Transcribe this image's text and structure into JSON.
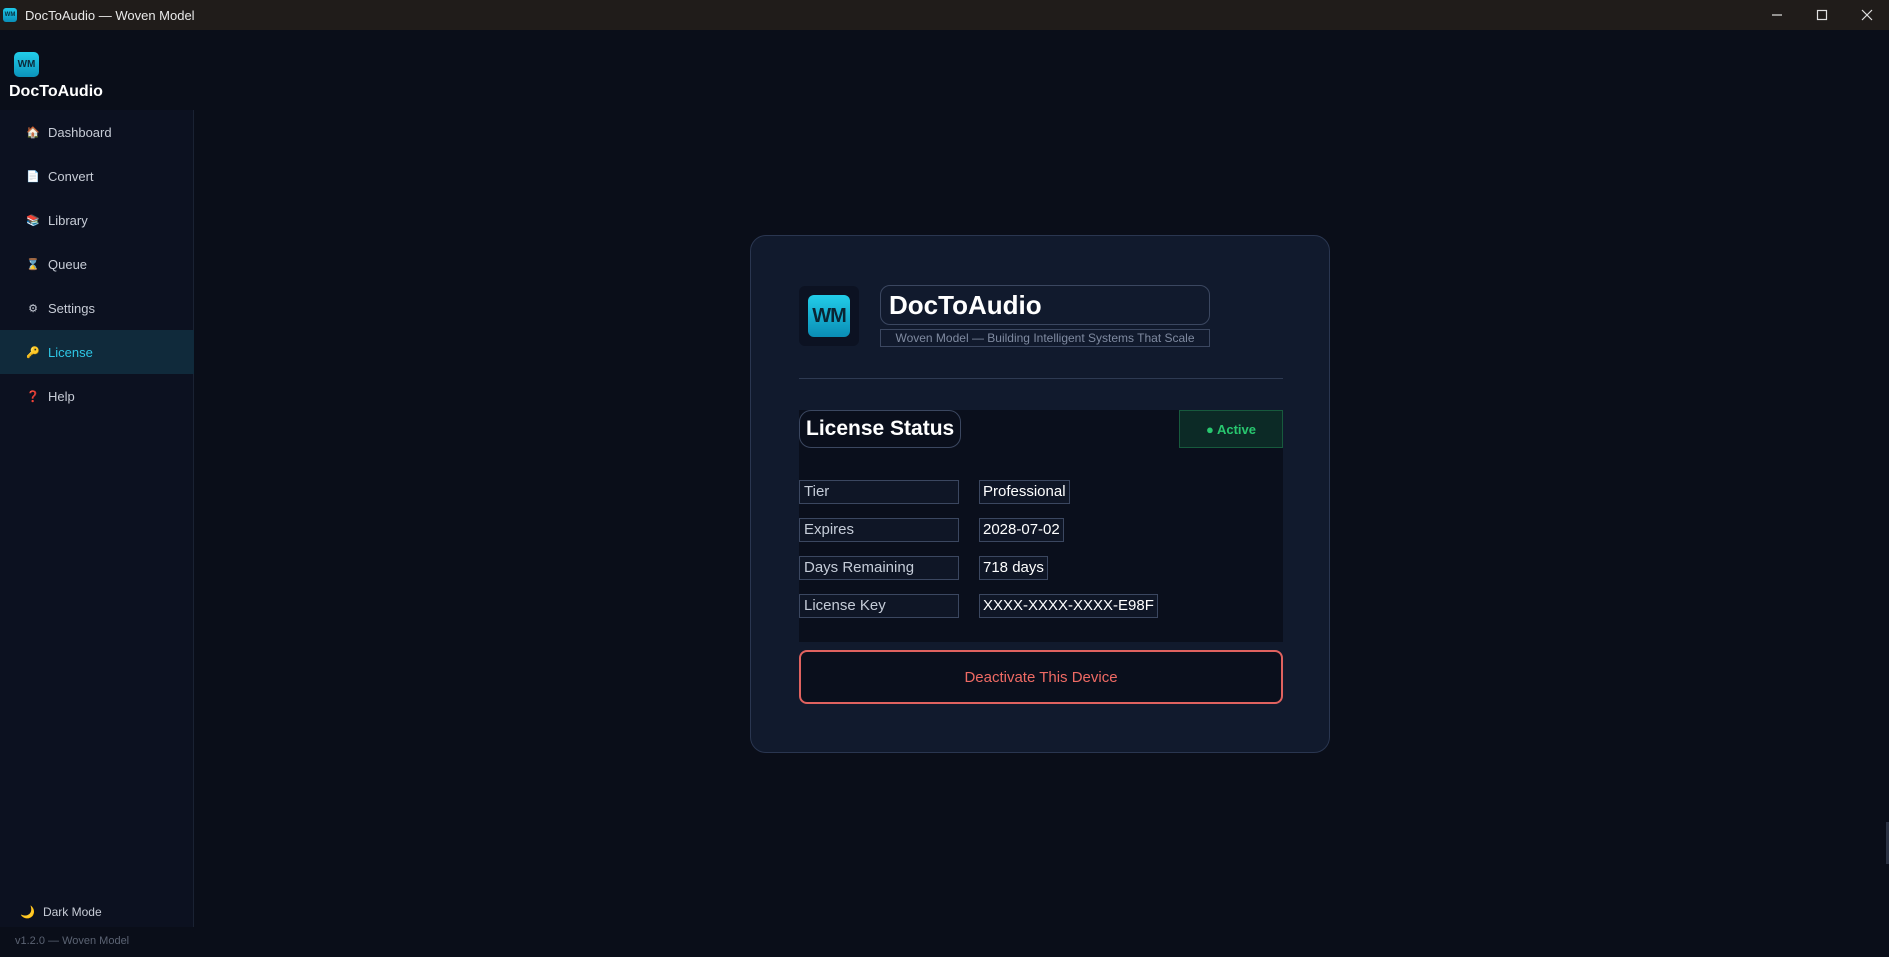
{
  "window": {
    "title": "DocToAudio — Woven Model",
    "icon_text": "WM"
  },
  "sidebar": {
    "logo_text": "WM",
    "brand_name": "DocToAudio",
    "items": [
      {
        "label": "Dashboard",
        "icon": "house-icon",
        "glyph": "🏠",
        "active": false
      },
      {
        "label": "Convert",
        "icon": "document-icon",
        "glyph": "📄",
        "active": false
      },
      {
        "label": "Library",
        "icon": "books-icon",
        "glyph": "📚",
        "active": false
      },
      {
        "label": "Queue",
        "icon": "hourglass-icon",
        "glyph": "⌛",
        "active": false
      },
      {
        "label": "Settings",
        "icon": "gear-icon",
        "glyph": "⚙",
        "active": false
      },
      {
        "label": "License",
        "icon": "key-icon",
        "glyph": "🔑",
        "active": true
      },
      {
        "label": "Help",
        "icon": "question-icon",
        "glyph": "❓",
        "active": false
      }
    ],
    "dark_mode_label": "Dark Mode",
    "version": "v1.2.0 — Woven Model"
  },
  "card": {
    "logo_text": "WM",
    "app_title": "DocToAudio",
    "subtitle": "Woven Model — Building Intelligent Systems That Scale",
    "status_title": "License Status",
    "status_badge": "● Active",
    "rows": [
      {
        "label": "Tier",
        "value": "Professional"
      },
      {
        "label": "Expires",
        "value": "2028-07-02"
      },
      {
        "label": "Days Remaining",
        "value": "718 days"
      },
      {
        "label": "License Key",
        "value": "XXXX-XXXX-XXXX-E98F"
      }
    ],
    "deactivate_label": "Deactivate This Device"
  },
  "colors": {
    "accent": "#2ec7e6",
    "active_status": "#28c76f",
    "danger": "#ef6a64",
    "background": "#0a0e19"
  }
}
